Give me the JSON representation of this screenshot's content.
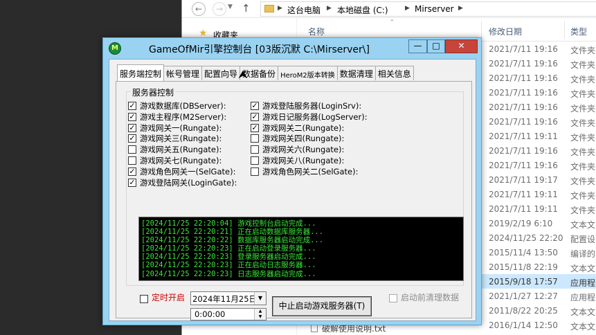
{
  "explorer": {
    "breadcrumb": [
      "这台电脑",
      "本地磁盘 (C:)",
      "Mirserver"
    ],
    "sidebar": {
      "favorites": "收藏夹"
    },
    "columns": {
      "name": "名称",
      "date": "修改日期",
      "type": "类型"
    },
    "rows": [
      {
        "date": "2021/7/11 19:16",
        "type": "文件夹"
      },
      {
        "date": "2021/7/11 19:16",
        "type": "文件夹"
      },
      {
        "date": "2021/7/11 19:16",
        "type": "文件夹"
      },
      {
        "date": "2021/7/11 19:16",
        "type": "文件夹"
      },
      {
        "date": "2021/7/11 19:16",
        "type": "文件夹"
      },
      {
        "date": "2021/7/11 19:16",
        "type": "文件夹"
      },
      {
        "date": "2021/7/11 19:11",
        "type": "文件夹"
      },
      {
        "date": "2021/7/11 19:16",
        "type": "文件夹"
      },
      {
        "date": "2021/7/11 19:16",
        "type": "文件夹"
      },
      {
        "date": "2021/7/11 19:17",
        "type": "文件夹"
      },
      {
        "date": "2021/7/11 19:11",
        "type": "文件夹"
      },
      {
        "date": "2021/7/11 19:11",
        "type": "文件夹"
      },
      {
        "date": "2019/2/19 6:10",
        "type": "文本文"
      },
      {
        "date": "2024/11/25 22:20",
        "type": "配置设"
      },
      {
        "date": "2015/11/4 13:50",
        "type": "编译的"
      },
      {
        "date": "2015/11/8 22:19",
        "type": "文本文"
      },
      {
        "date": "2015/9/18 17:57",
        "type": "应用程",
        "selected": true
      },
      {
        "date": "2021/1/27 12:27",
        "type": "应用程"
      },
      {
        "date": "2011/8/22 20:25",
        "type": "文本文"
      },
      {
        "date": "2016/1/14 12:50",
        "type": "文本文"
      }
    ],
    "readme_name": "破解使用说明.txt"
  },
  "dialog": {
    "title": "GameOfMir引擎控制台 [03版沉默 C:\\Mirserver\\]",
    "buttons": {
      "minimize": "—",
      "maximize": "□",
      "close": "✕"
    },
    "tabs": [
      "服务端控制",
      "帐号管理",
      "配置向导",
      "数据备份",
      "HeroM2版本转换",
      "数据清理",
      "相关信息"
    ],
    "group_label": "服务器控制",
    "left_checks": [
      {
        "label": "游戏数据库(DBServer):",
        "checked": true
      },
      {
        "label": "游戏主程序(M2Server):",
        "checked": true
      },
      {
        "label": "游戏网关一(Rungate):",
        "checked": true
      },
      {
        "label": "游戏网关三(Rungate):",
        "checked": true
      },
      {
        "label": "游戏网关五(Rungate):",
        "checked": false
      },
      {
        "label": "游戏网关七(Rungate):",
        "checked": false
      },
      {
        "label": "游戏角色网关一(SelGate):",
        "checked": true
      },
      {
        "label": "游戏登陆网关(LoginGate):",
        "checked": true
      }
    ],
    "right_checks": [
      {
        "label": "游戏登陆服务器(LoginSrv):",
        "checked": true
      },
      {
        "label": "游戏日记服务器(LogServer):",
        "checked": true
      },
      {
        "label": "游戏网关二(Rungate):",
        "checked": true
      },
      {
        "label": "游戏网关四(Rungate):",
        "checked": false
      },
      {
        "label": "游戏网关六(Rungate):",
        "checked": false
      },
      {
        "label": "游戏网关八(Rungate):",
        "checked": false
      },
      {
        "label": "游戏角色网关二(SelGate):",
        "checked": false
      }
    ],
    "log": [
      "[2024/11/25 22:20:04] 游戏控制台启动完成...",
      "[2024/11/25 22:20:21] 正在启动数据库服务器...",
      "[2024/11/25 22:20:22] 数据库服务器启动完成...",
      "[2024/11/25 22:20:23] 正在启动登录服务器...",
      "[2024/11/25 22:20:23] 登录服务器启动完成...",
      "[2024/11/25 22:20:23] 正在启动日志服务器...",
      "[2024/11/25 22:20:23] 日志服务器启动完成..."
    ],
    "timer_label": "定时开启",
    "timer_checked": false,
    "date_value": "2024年11月25日",
    "time_value": "0:00:00",
    "stop_button": "中止启动游戏服务器(T)",
    "preclean_label": "启动前清理数据",
    "preclean_checked": false
  },
  "colors": {
    "dialog_frame": "#9ad3f2",
    "log_text": "#3ae83a",
    "timer_label": "#d00000",
    "close_button": "#c7443a"
  }
}
